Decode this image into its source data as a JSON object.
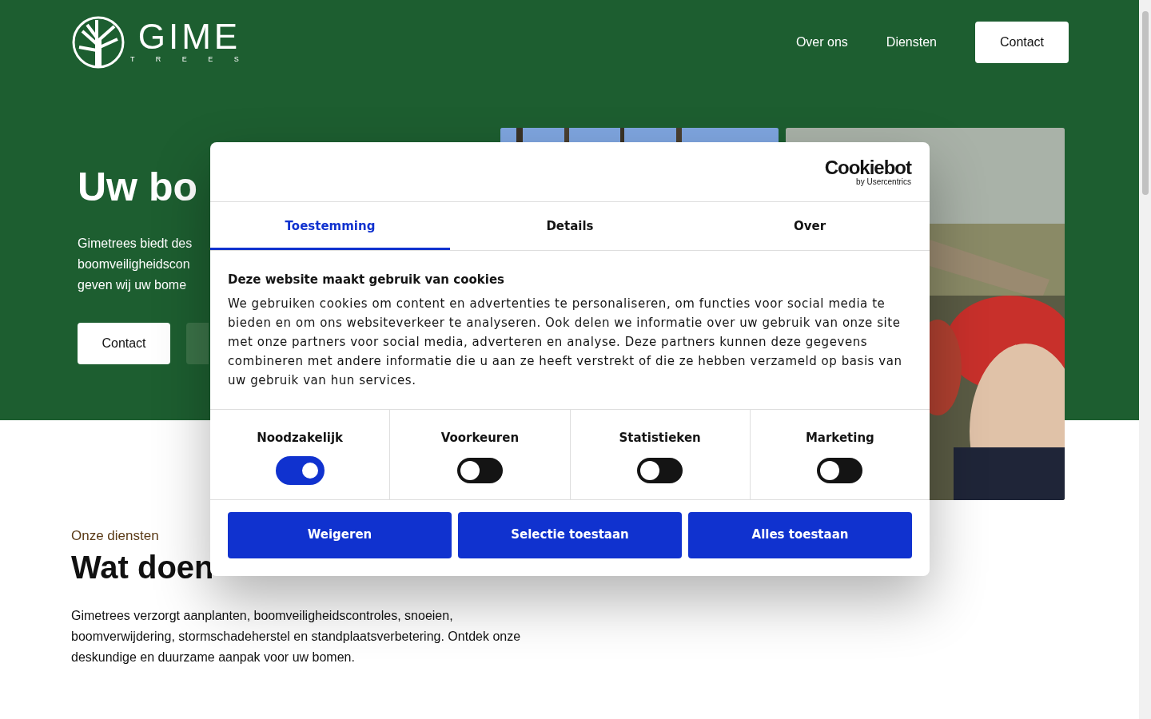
{
  "header": {
    "logo": {
      "word": "GIME",
      "sub": "T R E E S"
    },
    "nav": [
      {
        "label": "Over ons",
        "kind": "link"
      },
      {
        "label": "Diensten",
        "kind": "link"
      },
      {
        "label": "Contact",
        "kind": "button"
      }
    ]
  },
  "hero": {
    "title": "Uw bo",
    "lines": [
      "Gimetrees biedt des",
      "boomveiligheidscon",
      "geven wij uw bome"
    ],
    "buttons": [
      {
        "label": "Contact",
        "kind": "primary"
      },
      {
        "kind": "secondary"
      }
    ],
    "photos": [
      {
        "kind": "picture"
      },
      {
        "kind": "picture"
      }
    ]
  },
  "services": {
    "eyebrow": "Onze diensten",
    "title": "Wat doen",
    "text": "Gimetrees verzorgt aanplanten, boomveiligheidscontroles, snoeien, boomverwijdering, stormschadeherstel en standplaatsverbetering. Ontdek onze deskundige en duurzame aanpak voor uw bomen."
  },
  "cookie_dialog": {
    "brand": {
      "name": "Cookiebot",
      "by": "by Usercentrics"
    },
    "tabs": [
      {
        "label": "Toestemming",
        "selected": true
      },
      {
        "label": "Details",
        "selected": false
      },
      {
        "label": "Over",
        "selected": false
      }
    ],
    "heading": "Deze website maakt gebruik van cookies",
    "body": "We gebruiken cookies om content en advertenties te personaliseren, om functies voor social media te bieden en om ons websiteverkeer te analyseren. Ook delen we informatie over uw gebruik van onze site met onze partners voor social media, adverteren en analyse. Deze partners kunnen deze gegevens combineren met andere informatie die u aan ze heeft verstrekt of die ze hebben verzameld op basis van uw gebruik van hun services.",
    "categories": [
      {
        "label": "Noodzakelijk",
        "checked": true
      },
      {
        "label": "Voorkeuren",
        "checked": false
      },
      {
        "label": "Statistieken",
        "checked": false
      },
      {
        "label": "Marketing",
        "checked": false
      }
    ],
    "buttons": [
      "Weigeren",
      "Selectie toestaan",
      "Alles toestaan"
    ]
  }
}
